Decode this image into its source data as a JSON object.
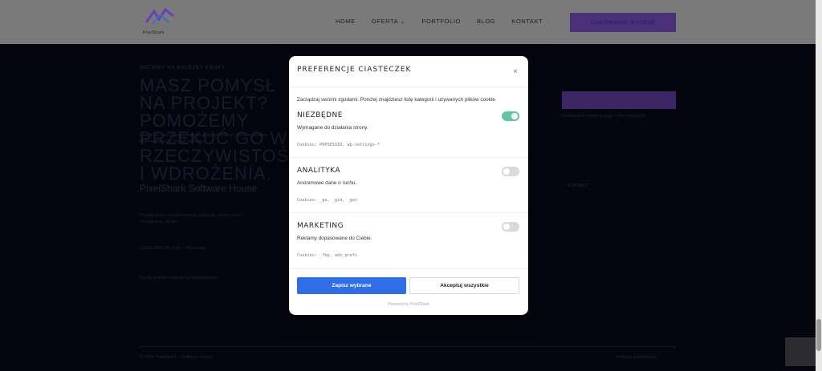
{
  "background": {
    "logo_text": "PixelShark",
    "nav": [
      "HOME",
      "OFERTA ⌄",
      "PORTFOLIO",
      "BLOG",
      "KONTAKT"
    ],
    "cta_top": "ZAMÓWIENIE WYCENĘ",
    "kicker": "GOTOWY NA KOLEJNY KROK?",
    "hero": "MASZ POMYSŁ NA PROJEKT? POMOŻEMY PRZEKUĆ GO W RZECZYWISTOŚĆ I WDROŻENIA.",
    "hero_sub": "Napisz do nas, a przygotujemy wstępną analizę i wycenę projektu dostosowaną do Twoich potrzeb.",
    "cta_right_note": "Odpowiadamy zwykle w ciągu 1 dnia roboczego",
    "footer_brand": "PixelShark Software House",
    "footer_desc": "Projektujemy i programujemy aplikacje, strony www i rozwiązania dla firm.",
    "footer_kv": "LOKALIZACJA: Łódź · Warszawa",
    "footer_note": "Każdy projekt realizujemy indywidualnie.",
    "contact": "KONTAKT",
    "copyright": "© 2025 PixelShark – Software House",
    "privacy": "Polityka prywatności"
  },
  "modal": {
    "title": "Preferencje ciasteczek",
    "close_symbol": "×",
    "intro": "Zarządzaj swoimi zgodami. Poniżej znajdziesz listę kategorii i używanych plików cookie.",
    "categories": [
      {
        "title": "Niezbędne",
        "desc": "Wymagane do działania strony.",
        "cookies": "Cookies: PHPSESSID, wp-settings-*",
        "enabled": true
      },
      {
        "title": "Analityka",
        "desc": "Anonimowe dane o ruchu.",
        "cookies": "Cookies: _ga, _gid, _gat",
        "enabled": false
      },
      {
        "title": "Marketing",
        "desc": "Reklamy dopasowane do Ciebie.",
        "cookies": "Cookies: _fbp, ads_prefs",
        "enabled": false
      }
    ],
    "save_label": "Zapisz wybrane",
    "accept_label": "Akceptuj wszystkie",
    "powered_by": "Powered by PixelShark"
  },
  "colors": {
    "accent_blue": "#2f6ee6",
    "toggle_on": "#5fc6a0",
    "toggle_off": "#d9d9d9",
    "overlay": "#05050f"
  }
}
